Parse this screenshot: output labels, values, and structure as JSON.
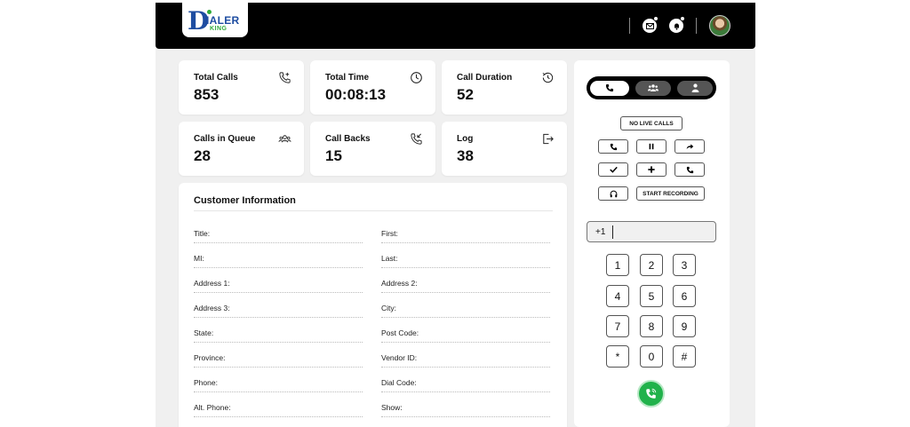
{
  "brand": {
    "logo_letter": "D",
    "logo_name": "IALER",
    "logo_sub": "KING"
  },
  "stats": [
    {
      "label": "Total  Calls",
      "value": "853",
      "icon": "phone-plus-icon"
    },
    {
      "label": "Total  Time",
      "value": "00:08:13",
      "icon": "clock-icon"
    },
    {
      "label": "Call Duration",
      "value": "52",
      "icon": "clock-history-icon"
    },
    {
      "label": "Calls in Queue",
      "value": "28",
      "icon": "users-icon"
    },
    {
      "label": "Call Backs",
      "value": "15",
      "icon": "phone-callback-icon"
    },
    {
      "label": "Log",
      "value": "38",
      "icon": "logout-icon"
    }
  ],
  "customer": {
    "title": "Customer Information",
    "fields_left": [
      "Title:",
      "MI:",
      "Address 1:",
      "Address 3:",
      "State:",
      "Province:",
      "Phone:",
      "Alt. Phone:"
    ],
    "fields_right": [
      "First:",
      "Last:",
      "Address 2:",
      "City:",
      "Post Code:",
      "Vendor ID:",
      "Dial Code:",
      "Show:"
    ]
  },
  "phone": {
    "no_live_calls": "NO LIVE CALLS",
    "start_recording": "START RECORDING",
    "dial_prefix": "+1",
    "keys": [
      "1",
      "2",
      "3",
      "4",
      "5",
      "6",
      "7",
      "8",
      "9",
      "*",
      "0",
      "#"
    ]
  },
  "colors": {
    "topbar": "#000000",
    "call_button": "#21b24b",
    "brand_blue": "#1e4da1",
    "brand_green": "#2eaa3a"
  }
}
